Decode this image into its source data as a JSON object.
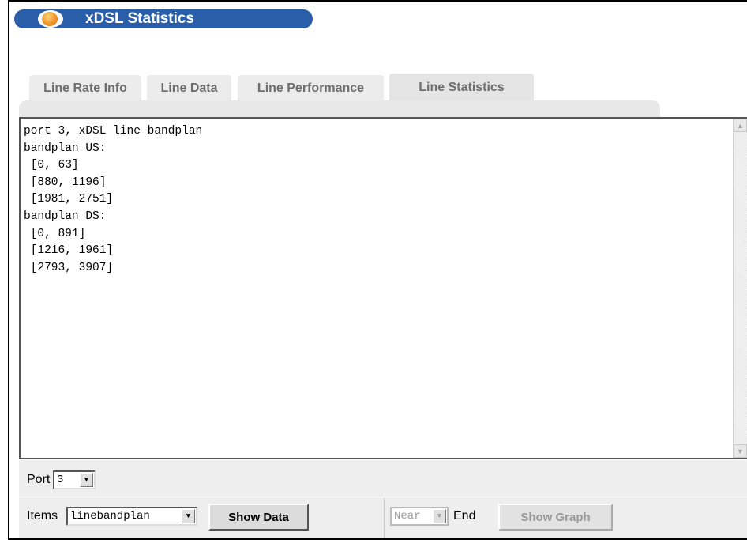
{
  "header": {
    "title": "xDSL Statistics"
  },
  "tabs": [
    {
      "label": "Line Rate Info",
      "active": false
    },
    {
      "label": "Line Data",
      "active": false
    },
    {
      "label": "Line Performance",
      "active": false
    },
    {
      "label": "Line Statistics",
      "active": true
    }
  ],
  "output": {
    "lines": [
      "port 3, xDSL line bandplan",
      "bandplan US:",
      " [0, 63]",
      " [880, 1196]",
      " [1981, 2751]",
      "bandplan DS:",
      " [0, 891]",
      " [1216, 1961]",
      " [2793, 3907]"
    ]
  },
  "controls": {
    "port_label": "Port",
    "port_value": "3",
    "items_label": "Items",
    "items_value": "linebandplan",
    "show_data_label": "Show Data",
    "near_value": "Near",
    "end_label": "End",
    "show_graph_label": "Show Graph"
  },
  "colors": {
    "title_bar": "#2b5ea8",
    "panel_bg": "#eeeeee"
  }
}
